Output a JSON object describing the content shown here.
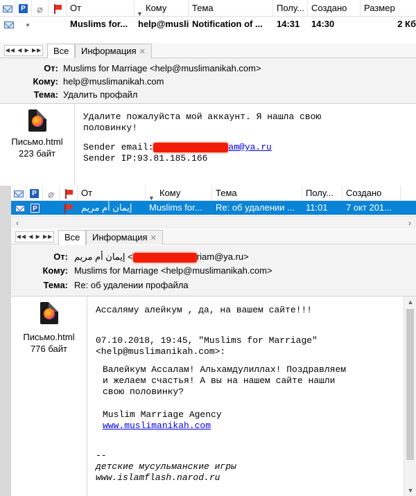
{
  "upper": {
    "list": {
      "columns": {
        "from": "От",
        "to": "Кому",
        "subject": "Тема",
        "received": "Полу...",
        "created": "Создано",
        "size": "Размер"
      },
      "row": {
        "from": "Muslims for...",
        "to": "help@musli...",
        "subject": "Notification of ...",
        "received": "14:31",
        "created": "14:30",
        "size": "2 Кб"
      }
    },
    "tabs": {
      "all": "Все",
      "info": "Информация"
    },
    "header": {
      "from_label": "От:",
      "from_value": "Muslims for Marriage <help@muslimanikah.com>",
      "to_label": "Кому:",
      "to_value": "help@muslimanikah.com",
      "subject_label": "Тема:",
      "subject_value": "Удалить профайл"
    },
    "attachment": {
      "name": "Письмо.html",
      "size": "223 байт"
    },
    "body": {
      "line1": "Удалите пожалуйста мой аккаунт. Я нашла свою",
      "line2": "половинку!",
      "email_label": "Sender email:",
      "email_visible": "am@ya.ru",
      "ip": "Sender IP:93.81.185.166"
    }
  },
  "lower": {
    "list": {
      "columns": {
        "from": "От",
        "to": "Кому",
        "subject": "Тема",
        "received": "Полу...",
        "created": "Создано"
      },
      "row": {
        "from": "إيمان أم مريم",
        "to": "Muslims for...",
        "subject": "Re: об удалении ...",
        "received": "11:01",
        "created": "7 окт 201..."
      }
    },
    "tabs": {
      "all": "Все",
      "info": "Информация"
    },
    "header": {
      "from_label": "От:",
      "from_name": "إيمان أم مريم",
      "from_open": "<",
      "from_email_visible": "riam@ya.ru>",
      "to_label": "Кому:",
      "to_value": "Muslims for Marriage <help@muslimanikah.com>",
      "subject_label": "Тема:",
      "subject_value": "Re: об удалении профайла"
    },
    "attachment": {
      "name": "Письмо.html",
      "size": "776 байт"
    },
    "body": {
      "line1": "Ассаляму алейкум , да, на вашем сайте!!!",
      "line2": "07.10.2018, 19:45, \"Muslims for Marriage\"",
      "line3": "<help@muslimanikah.com>:",
      "q1": "Валейкум Ассалам! Альхамдулиллах! Поздравляем",
      "q2": "и желаем счастья! А вы на нашем сайте нашли",
      "q3": "свою половинку?",
      "q4": "Muslim Marriage Agency",
      "q5": "www.muslimanikah.com",
      "sig_dash": "--",
      "sig1": "детские мусульманские игры",
      "sig2": "www.islamflash.narod.ru"
    }
  },
  "icons": [
    "envelope-icon",
    "p-icon",
    "paperclip-icon",
    "flag-icon",
    "firefox-file-icon",
    "close-icon",
    "chevron-down-icon",
    "scroll-left-icon",
    "scroll-right-icon"
  ],
  "colors": {
    "selected_row": "#0a84d6",
    "redaction": "#f21d06",
    "header_bg": "#f3f3f3",
    "link": "#0000ee"
  }
}
